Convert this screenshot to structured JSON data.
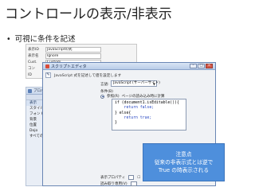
{
  "slide": {
    "title": "コントロールの表示/非表示",
    "bullet": "可視に条件を記述"
  },
  "background_grid": {
    "rows": [
      {
        "key": "表示ID",
        "value": "JavaScriptの式"
      },
      {
        "key": "表示名",
        "value": "Ignore"
      },
      {
        "key": "Cust.",
        "value": "Custom"
      },
      {
        "key": "コン",
        "value": "Calendar"
      },
      {
        "key": "ID",
        "value": "Calendar..."
      }
    ]
  },
  "left_panel": {
    "title": "プロパティ",
    "items": [
      {
        "label": "表示",
        "sep": true
      },
      {
        "label": "スタイル",
        "sep": false
      },
      {
        "label": "フォント",
        "sep": false
      },
      {
        "label": "背景",
        "sep": false
      },
      {
        "label": "位置",
        "sep": false
      },
      {
        "label": "Dojo",
        "sep": false
      },
      {
        "label": "すべてのプロパティ",
        "sep": false
      }
    ]
  },
  "dialog": {
    "title": "スクリプトエディタ",
    "description": "JavaScript 式を記述して値を設定します",
    "language_label": "言語:",
    "language_value": "JavaScript (サーバーサイド)",
    "condition_label": "条件(B)",
    "mode_option": "参照(R)",
    "mode_desc": "ページの読み込み時に計算",
    "code_lines": [
      "if (document1.isEditable()){",
      "    return false;",
      "} else{",
      "    return true;",
      "}"
    ],
    "visibility_label": "表示プロパティ",
    "visibility_value": "☐",
    "readonly_label": "読み取り専用(V)"
  },
  "callout": {
    "line1": "注意点",
    "line2": "従来の非表示式とは逆で",
    "line3": "True の時表示される"
  },
  "colors": {
    "callout_bg": "#4e8fdc",
    "dialog_title": "#b9cce8",
    "keyword": "#1f3fbf"
  }
}
